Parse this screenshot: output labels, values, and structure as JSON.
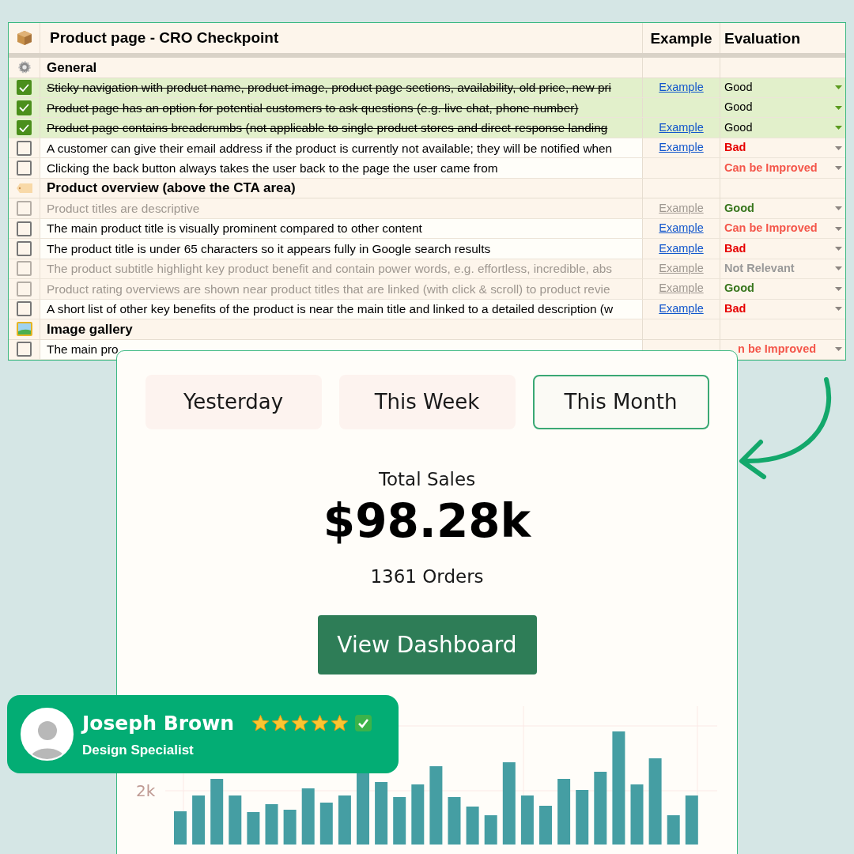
{
  "sheet": {
    "title": "Product page - CRO Checkpoint",
    "columns": [
      "Example",
      "Evaluation"
    ],
    "rows": [
      {
        "kind": "section",
        "label": "General"
      },
      {
        "kind": "item",
        "checked": true,
        "disabled": false,
        "text": "Sticky navigation with product name, product image, product page sections, availability, old price, new pri",
        "example": "Example",
        "evaluation": "Good",
        "color": "#000000"
      },
      {
        "kind": "item",
        "checked": true,
        "disabled": false,
        "text": "Product page has an option for potential customers to ask questions (e.g. live chat, phone number)",
        "evaluation": "Good",
        "color": "#000000"
      },
      {
        "kind": "item",
        "checked": true,
        "disabled": false,
        "text": "Product page contains breadcrumbs (not applicable to single product stores and direct-response landing",
        "example": "Example",
        "evaluation": "Good",
        "color": "#000000"
      },
      {
        "kind": "item",
        "checked": false,
        "disabled": false,
        "text": "A customer can give their email address if the product is currently not available; they will be notified when",
        "example": "Example",
        "evaluation": "Bad",
        "color": "#e60000"
      },
      {
        "kind": "item",
        "checked": false,
        "disabled": false,
        "text": "Clicking the back button always takes the user back to the page the user came from",
        "evaluation": "Can be Improved",
        "color": "#f4564a"
      },
      {
        "kind": "section",
        "label": "Product overview (above the CTA area)"
      },
      {
        "kind": "item",
        "checked": false,
        "disabled": true,
        "text": "Product titles are descriptive",
        "example": "Example",
        "evaluation": "Good",
        "color": "#38761d"
      },
      {
        "kind": "item",
        "checked": false,
        "disabled": false,
        "text": "The main product title is visually prominent compared to other content",
        "example": "Example",
        "evaluation": "Can be Improved",
        "color": "#f4564a"
      },
      {
        "kind": "item",
        "checked": false,
        "disabled": false,
        "text": "The product title is under 65 characters so it appears fully in Google search results",
        "example": "Example",
        "evaluation": "Bad",
        "color": "#e60000"
      },
      {
        "kind": "item",
        "checked": false,
        "disabled": true,
        "text": "The product subtitle highlight key product benefit and contain power words, e.g. effortless, incredible, abs",
        "example": "Example",
        "evaluation": "Not Relevant",
        "color": "#999999"
      },
      {
        "kind": "item",
        "checked": false,
        "disabled": true,
        "text": "Product rating overviews are shown near product titles that are linked (with click & scroll) to product revie",
        "example": "Example",
        "evaluation": "Good",
        "color": "#38761d"
      },
      {
        "kind": "item",
        "checked": false,
        "disabled": false,
        "text": "A short list of other key benefits of the product is near the main title and linked to a detailed description (w",
        "example": "Example",
        "evaluation": "Bad",
        "color": "#e60000"
      },
      {
        "kind": "section",
        "label": "Image gallery"
      },
      {
        "kind": "item",
        "checked": false,
        "disabled": false,
        "text": "The main pro",
        "evaluation": "n be Improved",
        "color": "#f4564a"
      }
    ]
  },
  "card": {
    "tabs": [
      {
        "label": "Yesterday",
        "selected": false
      },
      {
        "label": "This Week",
        "selected": false
      },
      {
        "label": "This Month",
        "selected": true
      }
    ],
    "metric_label": "Total Sales",
    "metric_value": "$98.28k",
    "orders": "1361 Orders",
    "button": "View Dashboard",
    "chart_axis_label": "2k"
  },
  "testimonial": {
    "name": "Joseph Brown",
    "role": "Design Specialist",
    "stars": 5
  }
}
